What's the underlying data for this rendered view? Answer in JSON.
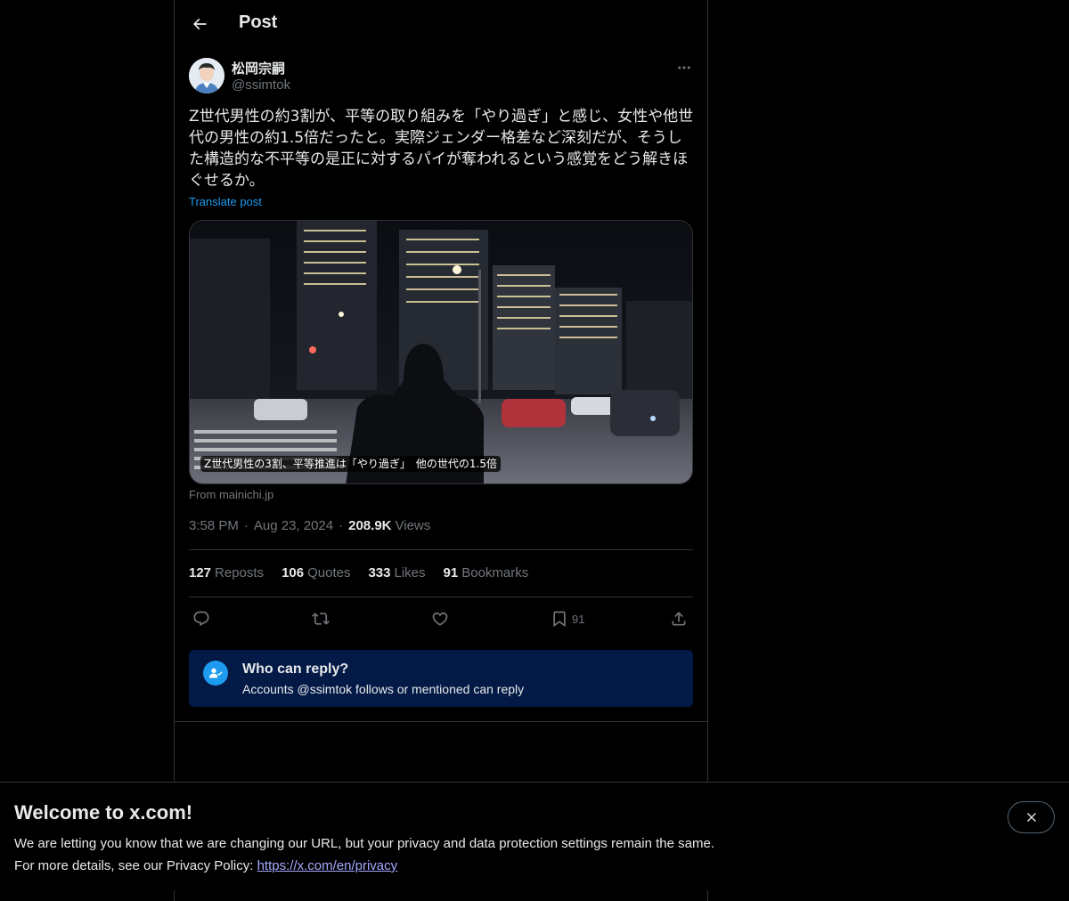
{
  "header": {
    "title": "Post",
    "back_icon": "arrow-left-icon"
  },
  "post": {
    "author_name": "松岡宗嗣",
    "author_handle": "@ssimtok",
    "text": "Z世代男性の約3割が、平等の取り組みを「やり過ぎ」と感じ、女性や他世代の男性の約1.5倍だったと。実際ジェンダー格差など深刻だが、そうした構造的な不平等の是正に対するパイが奪われるという感覚をどう解きほぐせるか。",
    "translate_label": "Translate post",
    "media_caption": "Z世代男性の3割、平等推進は「やり過ぎ」　他の世代の1.5倍",
    "media_source": "From mainichi.jp",
    "time": "3:58 PM",
    "date": "Aug 23, 2024",
    "views_count": "208.9K",
    "views_label": "Views",
    "separator": "·"
  },
  "stats": [
    {
      "count": "127",
      "label": "Reposts"
    },
    {
      "count": "106",
      "label": "Quotes"
    },
    {
      "count": "333",
      "label": "Likes"
    },
    {
      "count": "91",
      "label": "Bookmarks"
    }
  ],
  "actions": {
    "reply_icon": "reply-icon",
    "repost_icon": "repost-icon",
    "like_icon": "heart-icon",
    "bookmark_icon": "bookmark-icon",
    "bookmark_count": "91",
    "share_icon": "share-icon"
  },
  "reply_restriction": {
    "title": "Who can reply?",
    "subtitle": "Accounts @ssimtok follows or mentioned can reply"
  },
  "banner": {
    "title": "Welcome to x.com!",
    "line1": "We are letting you know that we are changing our URL, but your privacy and data protection settings remain the same.",
    "line2_prefix": "For more details, see our Privacy Policy: ",
    "link": "https://x.com/en/privacy"
  },
  "colors": {
    "background": "#000000",
    "text": "#e7e9ea",
    "muted": "#71767b",
    "accent": "#1d9bf0",
    "border": "#2f3336",
    "reply_box": "#031a47"
  }
}
